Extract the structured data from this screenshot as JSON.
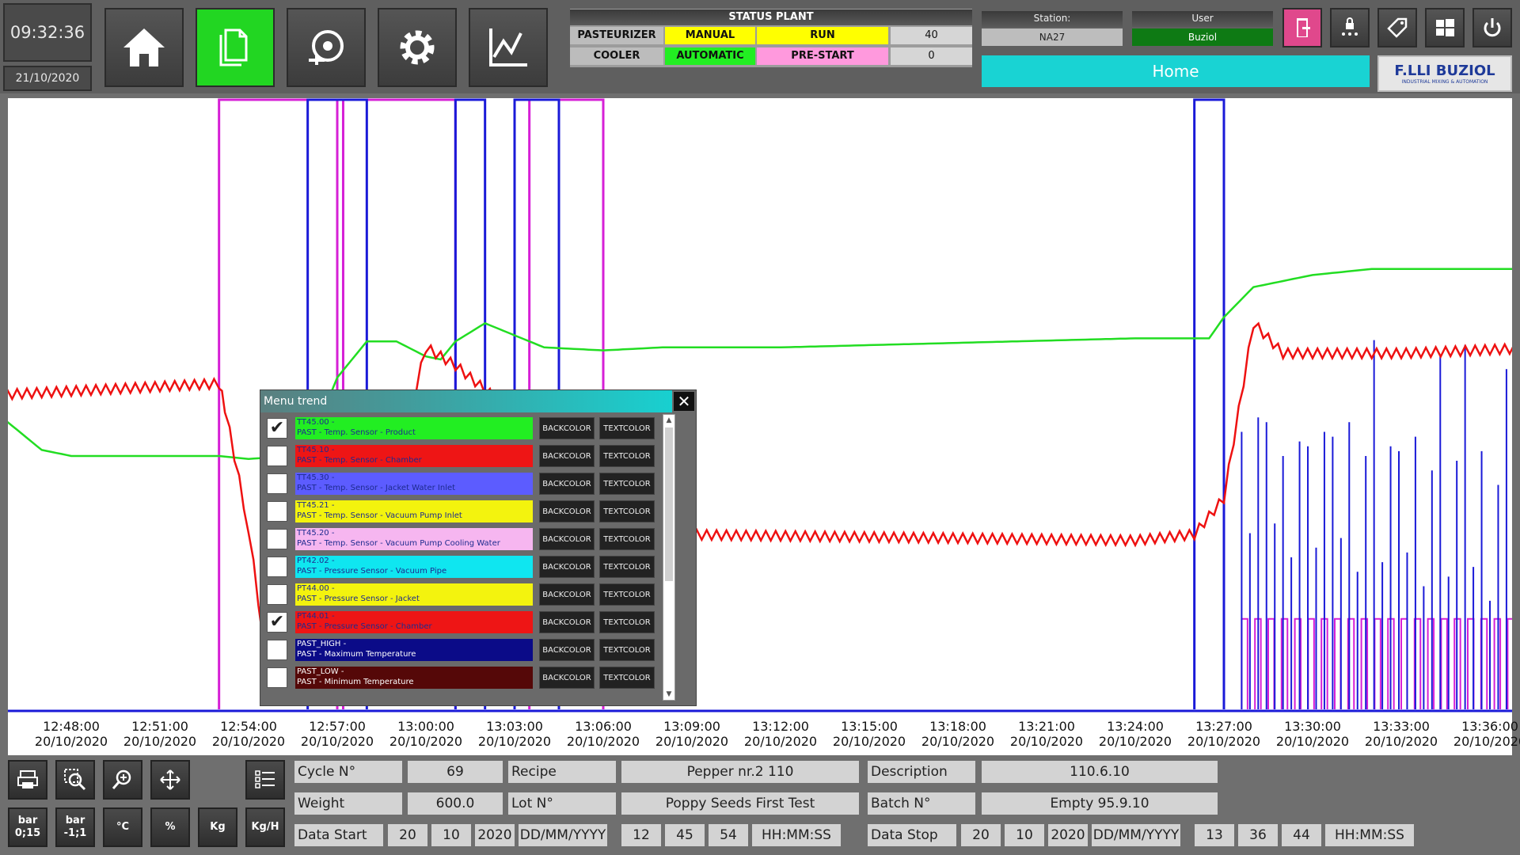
{
  "clock": {
    "time": "09:32:36",
    "date": "21/10/2020"
  },
  "nav": [
    "home-icon",
    "documents-icon",
    "alarm-bell-icon",
    "gear-icon",
    "trend-chart-icon"
  ],
  "status_plant": {
    "title": "STATUS PLANT",
    "rows": [
      {
        "name": "PASTEURIZER",
        "mode": "MANUAL",
        "state": "RUN",
        "value": "40",
        "mode_color": "#ffff00",
        "state_color": "#ffff00"
      },
      {
        "name": "COOLER",
        "mode": "AUTOMATIC",
        "state": "PRE-START",
        "value": "0",
        "mode_color": "#22ee22",
        "state_color": "#ff99dd"
      }
    ]
  },
  "station": {
    "label": "Station:",
    "value": "NA27"
  },
  "user": {
    "label": "User",
    "value": "Buziol"
  },
  "home_label": "Home",
  "logo": {
    "name": "F.LLI BUZIOL",
    "tagline": "INDUSTRIAL MIXING & AUTOMATION"
  },
  "chart_data": {
    "type": "line",
    "x_ticks": [
      {
        "time": "12:48:00",
        "date": "20/10/2020"
      },
      {
        "time": "12:51:00",
        "date": "20/10/2020"
      },
      {
        "time": "12:54:00",
        "date": "20/10/2020"
      },
      {
        "time": "12:57:00",
        "date": "20/10/2020"
      },
      {
        "time": "13:00:00",
        "date": "20/10/2020"
      },
      {
        "time": "13:03:00",
        "date": "20/10/2020"
      },
      {
        "time": "13:06:00",
        "date": "20/10/2020"
      },
      {
        "time": "13:09:00",
        "date": "20/10/2020"
      },
      {
        "time": "13:12:00",
        "date": "20/10/2020"
      },
      {
        "time": "13:15:00",
        "date": "20/10/2020"
      },
      {
        "time": "13:18:00",
        "date": "20/10/2020"
      },
      {
        "time": "13:21:00",
        "date": "20/10/2020"
      },
      {
        "time": "13:24:00",
        "date": "20/10/2020"
      },
      {
        "time": "13:27:00",
        "date": "20/10/2020"
      },
      {
        "time": "13:30:00",
        "date": "20/10/2020"
      },
      {
        "time": "13:33:00",
        "date": "20/10/2020"
      },
      {
        "time": "13:36:00",
        "date": "20/10/2020"
      }
    ],
    "x_range_min": [
      -3,
      54
    ],
    "y_range": [
      0,
      100
    ],
    "series": [
      {
        "name": "TT45.00",
        "color": "#22dd22",
        "points": [
          [
            -3,
            52
          ],
          [
            -2.5,
            49
          ],
          [
            -1,
            43
          ],
          [
            0,
            42
          ],
          [
            3,
            42
          ],
          [
            5,
            42
          ],
          [
            6,
            41.5
          ],
          [
            7.5,
            42
          ],
          [
            8,
            43
          ],
          [
            9,
            55
          ],
          [
            10,
            61
          ],
          [
            11,
            61
          ],
          [
            12,
            58.5
          ],
          [
            12.5,
            58
          ],
          [
            13,
            61
          ],
          [
            14,
            64
          ],
          [
            15,
            62
          ],
          [
            16,
            60
          ],
          [
            18,
            59.5
          ],
          [
            20,
            60
          ],
          [
            24,
            60
          ],
          [
            28,
            60.5
          ],
          [
            32,
            61
          ],
          [
            36,
            61.5
          ],
          [
            38.5,
            61.5
          ],
          [
            39,
            65
          ],
          [
            40,
            70
          ],
          [
            42,
            72
          ],
          [
            44,
            73
          ],
          [
            48,
            73
          ],
          [
            49,
            73
          ],
          [
            50,
            70
          ],
          [
            51,
            65
          ],
          [
            53,
            58
          ],
          [
            56,
            53
          ],
          [
            60,
            50
          ],
          [
            64,
            48
          ],
          [
            68,
            46.5
          ],
          [
            72,
            45.5
          ],
          [
            76,
            44.7
          ],
          [
            80,
            44.2
          ],
          [
            84,
            44
          ],
          [
            88,
            43.7
          ],
          [
            93,
            43.5
          ]
        ]
      },
      {
        "name": "PT44.01",
        "color": "#ee1111",
        "zigzag": true,
        "points": [
          [
            -3,
            52
          ],
          [
            5,
            54
          ],
          [
            5.2,
            50
          ],
          [
            6,
            30
          ],
          [
            6.5,
            12
          ],
          [
            7,
            7
          ],
          [
            8,
            5
          ],
          [
            10,
            5
          ],
          [
            10.5,
            9
          ],
          [
            11,
            40
          ],
          [
            12,
            60
          ],
          [
            13,
            57
          ],
          [
            20,
            29
          ],
          [
            36,
            28
          ],
          [
            38,
            29
          ],
          [
            39,
            35
          ],
          [
            40,
            64
          ],
          [
            41,
            59
          ],
          [
            45,
            59
          ],
          [
            50,
            60
          ],
          [
            50.2,
            55
          ],
          [
            51,
            42
          ],
          [
            52,
            30
          ],
          [
            54,
            20
          ],
          [
            56,
            14
          ],
          [
            58,
            10
          ],
          [
            60,
            8
          ],
          [
            64,
            6
          ],
          [
            68,
            5
          ],
          [
            72,
            4
          ],
          [
            76,
            4
          ],
          [
            80,
            4
          ],
          [
            84,
            3.5
          ],
          [
            88,
            3.5
          ],
          [
            93,
            3.5
          ],
          [
            93.2,
            50
          ]
        ]
      }
    ],
    "pulses": {
      "blue": [
        [
          8,
          10
        ],
        [
          13,
          14
        ],
        [
          15,
          16.5
        ],
        [
          38,
          39
        ]
      ],
      "magenta": [
        [
          5,
          9
        ],
        [
          9.2,
          13
        ],
        [
          15.5,
          18
        ],
        [
          49.8,
          95
        ]
      ]
    }
  },
  "trend_menu": {
    "title": "Menu trend",
    "back_label": "BACKCOLOR",
    "text_label": "TEXTCOLOR",
    "items": [
      {
        "tag": "TT45.00 -",
        "desc": "PAST - Temp. Sensor - Product",
        "checked": true,
        "bg": "#22ee22",
        "fg": "#1d2b8f"
      },
      {
        "tag": "TT45.10 -",
        "desc": "PAST - Temp. Sensor - Chamber",
        "checked": false,
        "bg": "#ee1515",
        "fg": "#1d2b8f"
      },
      {
        "tag": "TT45.30 -",
        "desc": "PAST - Temp. Sensor - Jacket Water Inlet",
        "checked": false,
        "bg": "#5c5cff",
        "fg": "#1d2b8f"
      },
      {
        "tag": "TT45.21 -",
        "desc": "PAST - Temp. Sensor - Vacuum Pump Inlet",
        "checked": false,
        "bg": "#f3f30e",
        "fg": "#1d2b8f"
      },
      {
        "tag": "TT45.20 -",
        "desc": "PAST - Temp. Sensor - Vacuum Pump Cooling Water",
        "checked": false,
        "bg": "#f6b6f0",
        "fg": "#1d2b8f"
      },
      {
        "tag": "PT42.02 -",
        "desc": "PAST - Pressure Sensor - Vacuum Pipe",
        "checked": false,
        "bg": "#0fe6f0",
        "fg": "#1d2b8f"
      },
      {
        "tag": "PT44.00 -",
        "desc": "PAST - Pressure Sensor - Jacket",
        "checked": false,
        "bg": "#f3f30e",
        "fg": "#1d2b8f"
      },
      {
        "tag": "PT44.01 -",
        "desc": "PAST - Pressure Sensor - Chamber",
        "checked": true,
        "bg": "#ee1515",
        "fg": "#1d2b8f"
      },
      {
        "tag": "PAST_HIGH -",
        "desc": "PAST - Maximum Temperature",
        "checked": false,
        "bg": "#0b0b88",
        "fg": "#ffffff"
      },
      {
        "tag": "PAST_LOW -",
        "desc": "PAST - Minimum Temperature",
        "checked": false,
        "bg": "#550808",
        "fg": "#ffffff"
      }
    ]
  },
  "toolbar": {
    "icons": [
      "print-report-icon",
      "zoom-area-icon",
      "zoom-in-icon",
      "pan-move-icon"
    ],
    "list_icon": "trend-list-icon",
    "units": [
      {
        "line1": "bar",
        "line2": "0;15"
      },
      {
        "line1": "bar",
        "line2": "-1;1"
      },
      {
        "line1": "°C",
        "line2": ""
      },
      {
        "line1": "%",
        "line2": ""
      },
      {
        "line1": "Kg",
        "line2": ""
      },
      {
        "line1": "Kg/H",
        "line2": ""
      }
    ]
  },
  "info": {
    "cycle_label": "Cycle N°",
    "cycle": "69",
    "recipe_label": "Recipe",
    "recipe": "Pepper nr.2 110",
    "description_label": "Description",
    "description": "110.6.10",
    "weight_label": "Weight",
    "weight": "600.0",
    "lot_label": "Lot N°",
    "lot": "Poppy Seeds First Test",
    "batch_label": "Batch N°",
    "batch": "Empty 95.9.10",
    "start_label": "Data Start",
    "start_d": "20",
    "start_m": "10",
    "start_y": "2020",
    "date_fmt": "DD/MM/YYYY",
    "start_h": "12",
    "start_min": "45",
    "start_s": "54",
    "time_fmt": "HH:MM:SS",
    "stop_label": "Data Stop",
    "stop_d": "20",
    "stop_m": "10",
    "stop_y": "2020",
    "stop_h": "13",
    "stop_min": "36",
    "stop_s": "44"
  }
}
